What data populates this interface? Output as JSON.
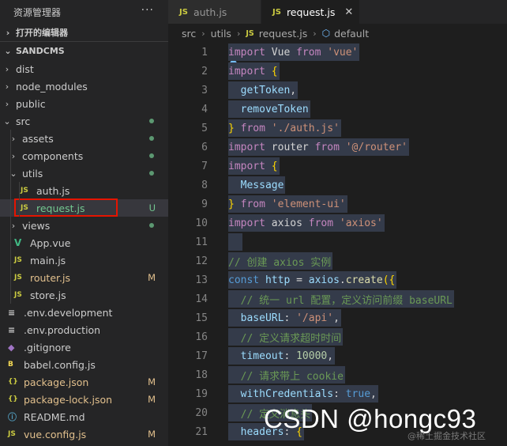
{
  "explorer": {
    "title": "资源管理器",
    "more": "···",
    "open_editors_label": "打开的编辑器",
    "project_label": "SANDCMS"
  },
  "tree": [
    {
      "label": "dist",
      "icon": "chevron-right-icon",
      "kind": "folder",
      "status": ""
    },
    {
      "label": "node_modules",
      "icon": "chevron-right-icon",
      "kind": "folder",
      "status": ""
    },
    {
      "label": "public",
      "icon": "chevron-right-icon",
      "kind": "folder",
      "status": ""
    },
    {
      "label": "src",
      "icon": "chevron-down-icon",
      "kind": "folder",
      "status": "dot"
    },
    {
      "label": "assets",
      "icon": "chevron-right-icon",
      "kind": "folder",
      "status": "dot"
    },
    {
      "label": "components",
      "icon": "chevron-right-icon",
      "kind": "folder",
      "status": "dot"
    },
    {
      "label": "utils",
      "icon": "chevron-down-icon",
      "kind": "folder",
      "status": "dot"
    },
    {
      "label": "auth.js",
      "icon": "js-file-icon",
      "kind": "file",
      "badge": "JS",
      "status": ""
    },
    {
      "label": "request.js",
      "icon": "js-file-icon",
      "kind": "file",
      "badge": "JS",
      "status": "U"
    },
    {
      "label": "views",
      "icon": "chevron-right-icon",
      "kind": "folder",
      "status": "dot"
    },
    {
      "label": "App.vue",
      "icon": "vue-file-icon",
      "kind": "file",
      "badge": "V",
      "status": ""
    },
    {
      "label": "main.js",
      "icon": "js-file-icon",
      "kind": "file",
      "badge": "JS",
      "status": ""
    },
    {
      "label": "router.js",
      "icon": "js-file-icon",
      "kind": "file",
      "badge": "JS",
      "status": "M"
    },
    {
      "label": "store.js",
      "icon": "js-file-icon",
      "kind": "file",
      "badge": "JS",
      "status": ""
    },
    {
      "label": ".env.development",
      "icon": "env-file-icon",
      "kind": "file",
      "badge": "≡",
      "status": ""
    },
    {
      "label": ".env.production",
      "icon": "env-file-icon",
      "kind": "file",
      "badge": "≡",
      "status": ""
    },
    {
      "label": ".gitignore",
      "icon": "git-file-icon",
      "kind": "file",
      "badge": "◆",
      "status": ""
    },
    {
      "label": "babel.config.js",
      "icon": "babel-file-icon",
      "kind": "file",
      "badge": "B",
      "status": ""
    },
    {
      "label": "package.json",
      "icon": "json-file-icon",
      "kind": "file",
      "badge": "{}",
      "status": "M"
    },
    {
      "label": "package-lock.json",
      "icon": "json-file-icon",
      "kind": "file",
      "badge": "{}",
      "status": "M"
    },
    {
      "label": "README.md",
      "icon": "info-file-icon",
      "kind": "file",
      "badge": "ⓘ",
      "status": ""
    },
    {
      "label": "vue.config.js",
      "icon": "js-file-icon",
      "kind": "file",
      "badge": "JS",
      "status": "M"
    }
  ],
  "tabs": [
    {
      "label": "auth.js",
      "badge": "JS",
      "active": false
    },
    {
      "label": "request.js",
      "badge": "JS",
      "active": true,
      "close": "✕"
    }
  ],
  "breadcrumb": {
    "parts": [
      "src",
      "utils",
      "request.js",
      "default"
    ],
    "file_badge": "JS"
  },
  "editor": {
    "lines": [
      {
        "n": "1",
        "tokens": [
          [
            "kw",
            "import"
          ],
          [
            "pl",
            " Vue "
          ],
          [
            "kw",
            "from"
          ],
          [
            "pl",
            " "
          ],
          [
            "str",
            "'vue'"
          ]
        ]
      },
      {
        "n": "2",
        "tokens": [
          [
            "kw",
            "import"
          ],
          [
            "pl",
            " "
          ],
          [
            "br",
            "{"
          ]
        ]
      },
      {
        "n": "3",
        "tokens": [
          [
            "pl",
            "  "
          ],
          [
            "var",
            "getToken"
          ],
          [
            "pl",
            ","
          ]
        ]
      },
      {
        "n": "4",
        "tokens": [
          [
            "pl",
            "  "
          ],
          [
            "var",
            "removeToken"
          ]
        ]
      },
      {
        "n": "5",
        "tokens": [
          [
            "br",
            "}"
          ],
          [
            "pl",
            " "
          ],
          [
            "kw",
            "from"
          ],
          [
            "pl",
            " "
          ],
          [
            "str",
            "'./auth.js'"
          ]
        ]
      },
      {
        "n": "6",
        "tokens": [
          [
            "kw",
            "import"
          ],
          [
            "pl",
            " router "
          ],
          [
            "kw",
            "from"
          ],
          [
            "pl",
            " "
          ],
          [
            "str",
            "'@/router'"
          ]
        ]
      },
      {
        "n": "7",
        "tokens": [
          [
            "kw",
            "import"
          ],
          [
            "pl",
            " "
          ],
          [
            "br",
            "{"
          ]
        ]
      },
      {
        "n": "8",
        "tokens": [
          [
            "pl",
            "  "
          ],
          [
            "var",
            "Message"
          ]
        ]
      },
      {
        "n": "9",
        "tokens": [
          [
            "br",
            "}"
          ],
          [
            "pl",
            " "
          ],
          [
            "kw",
            "from"
          ],
          [
            "pl",
            " "
          ],
          [
            "str",
            "'element-ui'"
          ]
        ]
      },
      {
        "n": "10",
        "tokens": [
          [
            "kw",
            "import"
          ],
          [
            "pl",
            " axios "
          ],
          [
            "kw",
            "from"
          ],
          [
            "pl",
            " "
          ],
          [
            "str",
            "'axios'"
          ]
        ]
      },
      {
        "n": "11",
        "tokens": [
          [
            "pl",
            "  "
          ]
        ]
      },
      {
        "n": "12",
        "tokens": [
          [
            "cm",
            "// 创建 axios 实例"
          ]
        ]
      },
      {
        "n": "13",
        "tokens": [
          [
            "kw2",
            "const"
          ],
          [
            "pl",
            " "
          ],
          [
            "var",
            "http"
          ],
          [
            "pl",
            " = "
          ],
          [
            "var",
            "axios"
          ],
          [
            "pl",
            "."
          ],
          [
            "fn",
            "create"
          ],
          [
            "br",
            "({"
          ]
        ]
      },
      {
        "n": "14",
        "tokens": [
          [
            "pl",
            "  "
          ],
          [
            "cm",
            "// 统一 url 配置，定义访问前缀 baseURL"
          ]
        ]
      },
      {
        "n": "15",
        "tokens": [
          [
            "pl",
            "  "
          ],
          [
            "var",
            "baseURL"
          ],
          [
            "pl",
            ": "
          ],
          [
            "str",
            "'/api'"
          ],
          [
            "pl",
            ","
          ]
        ]
      },
      {
        "n": "16",
        "tokens": [
          [
            "pl",
            "  "
          ],
          [
            "cm",
            "// 定义请求超时时间"
          ]
        ]
      },
      {
        "n": "17",
        "tokens": [
          [
            "pl",
            "  "
          ],
          [
            "var",
            "timeout"
          ],
          [
            "pl",
            ": "
          ],
          [
            "num",
            "10000"
          ],
          [
            "pl",
            ","
          ]
        ]
      },
      {
        "n": "18",
        "tokens": [
          [
            "pl",
            "  "
          ],
          [
            "cm",
            "// 请求带上 cookie"
          ]
        ]
      },
      {
        "n": "19",
        "tokens": [
          [
            "pl",
            "  "
          ],
          [
            "var",
            "withCredentials"
          ],
          [
            "pl",
            ": "
          ],
          [
            "kw2",
            "true"
          ],
          [
            "pl",
            ","
          ]
        ]
      },
      {
        "n": "20",
        "tokens": [
          [
            "pl",
            "  "
          ],
          [
            "cm",
            "// 定义消息头"
          ]
        ]
      },
      {
        "n": "21",
        "tokens": [
          [
            "pl",
            "  "
          ],
          [
            "var",
            "headers"
          ],
          [
            "pl",
            ": "
          ],
          [
            "br",
            "{"
          ]
        ]
      }
    ]
  },
  "watermark": {
    "main": "CSDN @hongc93",
    "sub": "@稀土掘金技术社区"
  },
  "colors": {
    "js_badge": "#cbcb41",
    "vue_badge": "#41b883",
    "json_badge": "#cbcb41",
    "modified": "#e2c08d",
    "untracked": "#73c991",
    "highlight_box": "#e51400"
  }
}
